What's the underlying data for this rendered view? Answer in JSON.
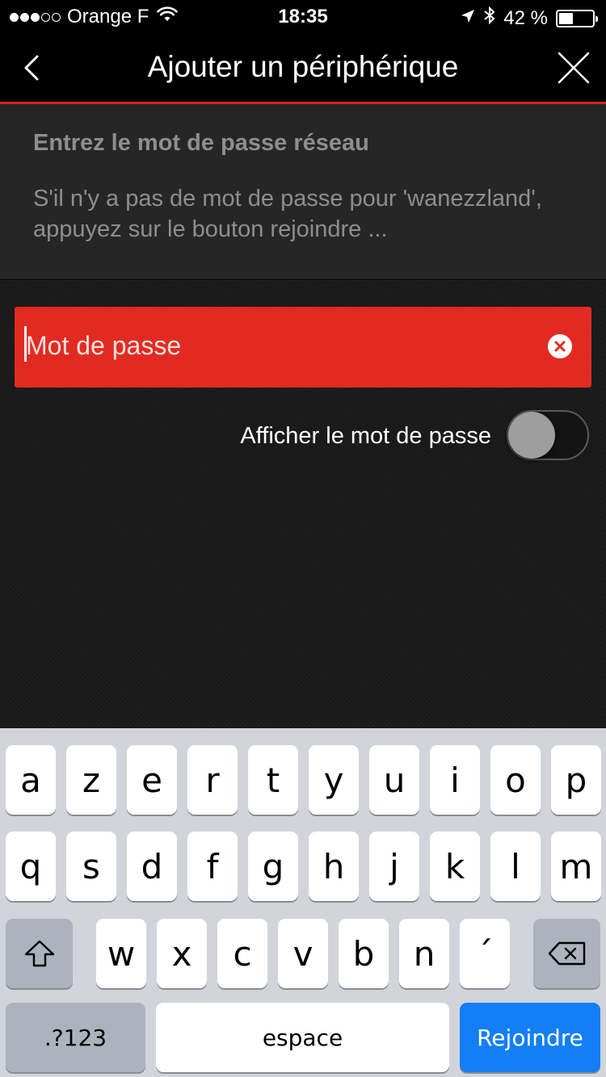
{
  "status_bar": {
    "carrier": "Orange F",
    "time": "18:35",
    "battery": "42 %",
    "battery_level": 0.42,
    "signal_dots_filled": 3,
    "signal_dots_total": 5
  },
  "nav": {
    "title": "Ajouter un périphérique"
  },
  "info": {
    "title": "Entrez le mot de passe réseau",
    "text": "S'il n'y a pas de mot de passe pour 'wanezzland', appuyez sur le bouton rejoindre ..."
  },
  "password": {
    "placeholder": "Mot de passe",
    "value": "",
    "show_password_label": "Afficher le mot de passe",
    "show_password_on": false
  },
  "keyboard": {
    "row1": [
      "a",
      "z",
      "e",
      "r",
      "t",
      "y",
      "u",
      "i",
      "o",
      "p"
    ],
    "row2": [
      "q",
      "s",
      "d",
      "f",
      "g",
      "h",
      "j",
      "k",
      "l",
      "m"
    ],
    "row3": [
      "w",
      "x",
      "c",
      "v",
      "b",
      "n",
      "´"
    ],
    "numbers_label": ".?123",
    "space_label": "espace",
    "return_label": "Rejoindre"
  },
  "colors": {
    "accent": "#e12b22",
    "nav_line": "#d7261e",
    "return_key": "#137ef6"
  }
}
